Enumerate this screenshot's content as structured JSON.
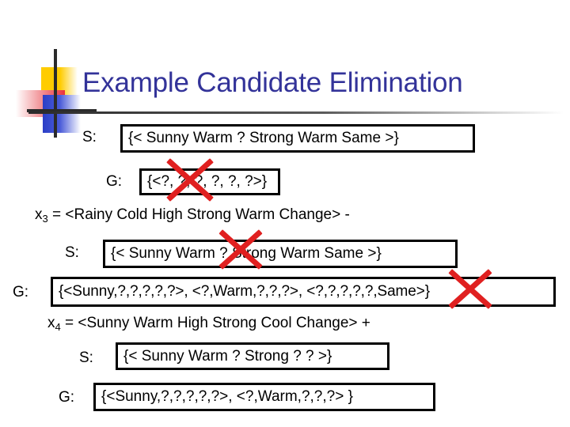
{
  "slide": {
    "title": "Example Candidate Elimination",
    "title_color": "#333399",
    "strike_color": "#e02020"
  },
  "logo": {
    "name": "powerpoint-design-mark",
    "yellow": "#ffcc00",
    "red": "#e8323c",
    "blue": "#2b3ec6",
    "bar": "#2b2b2b"
  },
  "rows": {
    "s1": {
      "label": "S:",
      "value": "{< Sunny Warm ? Strong Warm Same >}",
      "struck": false
    },
    "g1": {
      "label": "G:",
      "value": "{<?, ?, ?, ?, ?, ?>}",
      "struck": true
    },
    "x3": {
      "name": "x",
      "subscript": "3",
      "equals": " = ",
      "instance": "<Rainy  Cold   High     Strong Warm Change>",
      "classification": "-",
      "text": "x3 = <Rainy  Cold   High     Strong Warm Change> -"
    },
    "s2": {
      "label": "S:",
      "value": "{< Sunny Warm ? Strong Warm Same >}",
      "struck": true
    },
    "g2": {
      "label": "G:",
      "value": "{<Sunny,?,?,?,?,?>, <?,Warm,?,?,?>,  <?,?,?,?,?,Same>}",
      "struck": true
    },
    "x4": {
      "name": "x",
      "subscript": "4",
      "equals": " = ",
      "instance": "<Sunny Warm High    Strong Cool  Change>",
      "classification": "+",
      "text": "x4 = <Sunny Warm High    Strong Cool  Change> +"
    },
    "s3": {
      "label": "S:",
      "value": "{< Sunny Warm ? Strong ? ? >}",
      "struck": false
    },
    "g3": {
      "label": "G:",
      "value": "{<Sunny,?,?,?,?,?>, <?,Warm,?,?,?> }",
      "struck": false
    }
  }
}
